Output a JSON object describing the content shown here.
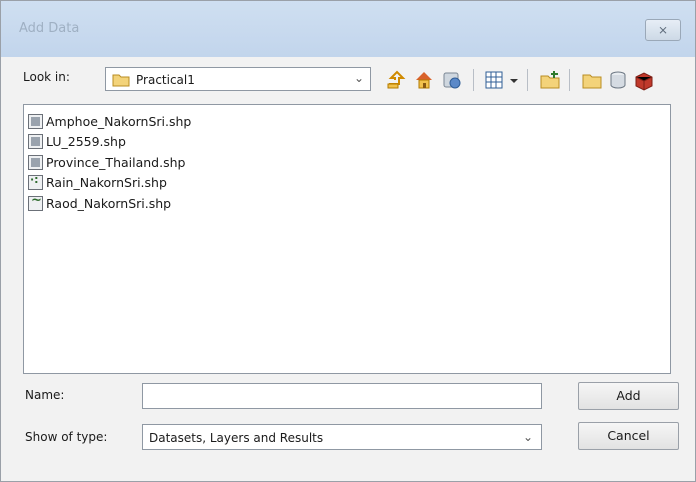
{
  "window": {
    "title": "Add Data",
    "close_glyph": "⨯"
  },
  "toolbar": {
    "lookin_label": "Look in:",
    "lookin_value": "Practical1",
    "icons": [
      "up-one-level-icon",
      "home-icon",
      "catalog-icon",
      "view-options-icon",
      "connect-folder-icon",
      "new-folder-icon",
      "database-icon",
      "toolbox-icon"
    ]
  },
  "files": [
    {
      "name": "Amphoe_NakornSri.shp",
      "icon": "polygon-shapefile-icon"
    },
    {
      "name": "LU_2559.shp",
      "icon": "polygon-shapefile-icon"
    },
    {
      "name": "Province_Thailand.shp",
      "icon": "polygon-shapefile-icon"
    },
    {
      "name": "Rain_NakornSri.shp",
      "icon": "point-shapefile-icon"
    },
    {
      "name": "Raod_NakornSri.shp",
      "icon": "line-shapefile-icon"
    }
  ],
  "form": {
    "name_label": "Name:",
    "name_value": "",
    "type_label": "Show of type:",
    "type_value": "Datasets, Layers and Results"
  },
  "buttons": {
    "add": "Add",
    "cancel": "Cancel"
  },
  "colors": {
    "titlebar": "#c8daef",
    "accent_icon": "#e6a817"
  }
}
